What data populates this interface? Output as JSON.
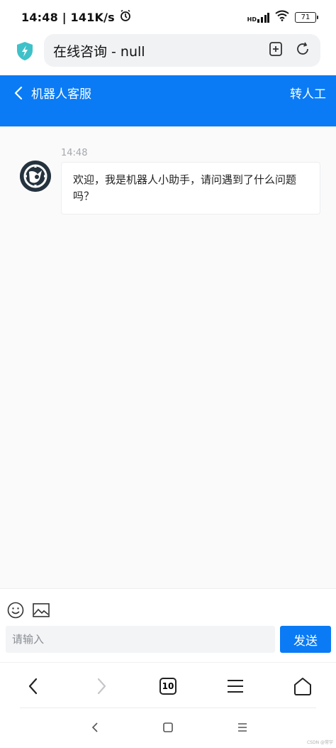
{
  "status": {
    "time": "14:48 | 141K/s",
    "network_badge": "HD",
    "battery": "71"
  },
  "browser": {
    "url_title": "在线咨询 - null"
  },
  "header": {
    "title": "机器人客服",
    "transfer_label": "转人工"
  },
  "chat": {
    "messages": [
      {
        "time": "14:48",
        "text": "欢迎，我是机器人小助手，请问遇到了什么问题吗？"
      }
    ]
  },
  "composer": {
    "input_placeholder": "请输入",
    "input_value": "",
    "send_label": "发送"
  },
  "nav": {
    "tabs_count": "10"
  },
  "footer": {
    "watermark": "CSDN @常宇"
  },
  "colors": {
    "accent": "#0a7bf4",
    "chat_background": "#fafafb",
    "input_background": "#f3f4f6"
  }
}
